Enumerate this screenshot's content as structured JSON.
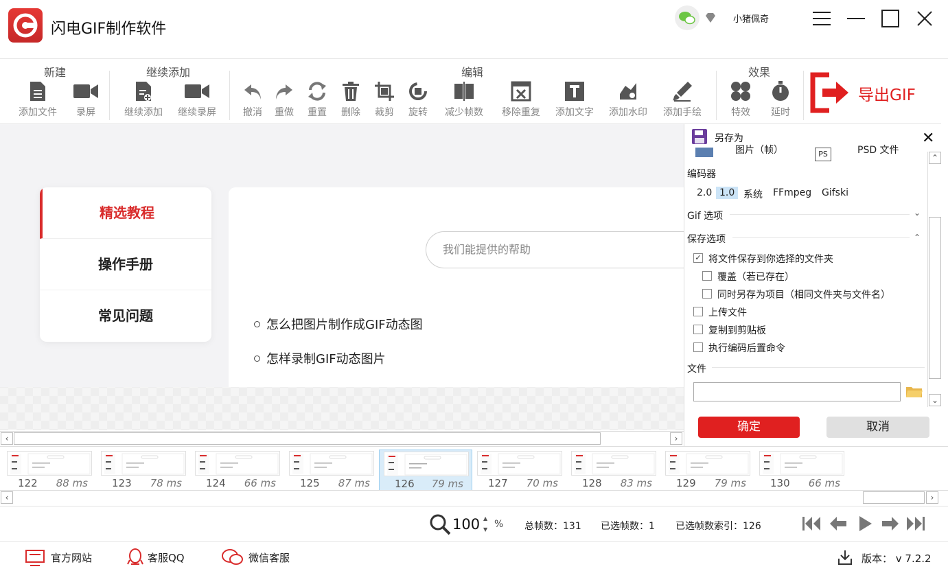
{
  "app": {
    "title": "闪电GIF制作软件",
    "username": "小猪佩奇"
  },
  "toolbar": {
    "groups": {
      "new": "新建",
      "continue": "继续添加",
      "edit": "编辑",
      "effects": "效果"
    },
    "items": {
      "add_file": "添加文件",
      "record": "录屏",
      "cont_add": "继续添加",
      "cont_record": "继续录屏",
      "undo": "撤消",
      "redo": "重做",
      "reset": "重置",
      "delete": "删除",
      "crop": "裁剪",
      "rotate": "旋转",
      "reduce_frames": "减少帧数",
      "remove_dup": "移除重复",
      "add_text": "添加文字",
      "add_watermark": "添加水印",
      "add_drawing": "添加手绘",
      "effect": "特效",
      "delay": "延时"
    },
    "export_label": "导出GIF"
  },
  "help": {
    "menu": [
      "精选教程",
      "操作手册",
      "常见问题"
    ],
    "search_placeholder": "我们能提供的帮助",
    "faqs": [
      "怎么把图片制作成GIF动态图",
      "怎样录制GIF动态图片"
    ]
  },
  "frames": [
    {
      "index": "122",
      "ms": "88 ms"
    },
    {
      "index": "123",
      "ms": "78 ms"
    },
    {
      "index": "124",
      "ms": "66 ms"
    },
    {
      "index": "125",
      "ms": "87 ms"
    },
    {
      "index": "126",
      "ms": "79 ms",
      "selected": true
    },
    {
      "index": "127",
      "ms": "70 ms"
    },
    {
      "index": "128",
      "ms": "83 ms"
    },
    {
      "index": "129",
      "ms": "79 ms"
    },
    {
      "index": "130",
      "ms": "66 ms"
    }
  ],
  "status": {
    "zoom": "100",
    "zoom_unit": "%",
    "total_frames": "总帧数：131",
    "selected_frames": "已选帧数：1",
    "selected_index": "已选帧数索引：126"
  },
  "bottom": {
    "website": "官方网站",
    "qq": "客服QQ",
    "wechat": "微信客服",
    "version": "版本： v 7.2.2"
  },
  "saveas": {
    "title": "另存为",
    "top_partial": [
      "图片（帧）",
      "PSD 文件"
    ],
    "encoder_label": "编码器",
    "encoders": [
      "2.0",
      "1.0",
      "系统",
      "FFmpeg",
      "Gifski"
    ],
    "active_encoder": "1.0",
    "gif_options": "Gif 选项",
    "save_options": "保存选项",
    "checks": {
      "save_to_folder": "将文件保存到你选择的文件夹",
      "overwrite": "覆盖（若已存在）",
      "save_project": "同时另存为项目（相同文件夹与文件名）",
      "upload": "上传文件",
      "copy_clipboard": "复制到剪贴板",
      "post_command": "执行编码后置命令"
    },
    "file_label": "文件",
    "ok": "确定",
    "cancel": "取消"
  },
  "colors": {
    "accent": "#e02020",
    "selected": "#d9ecf9",
    "encoder_active": "#cce4f7"
  }
}
